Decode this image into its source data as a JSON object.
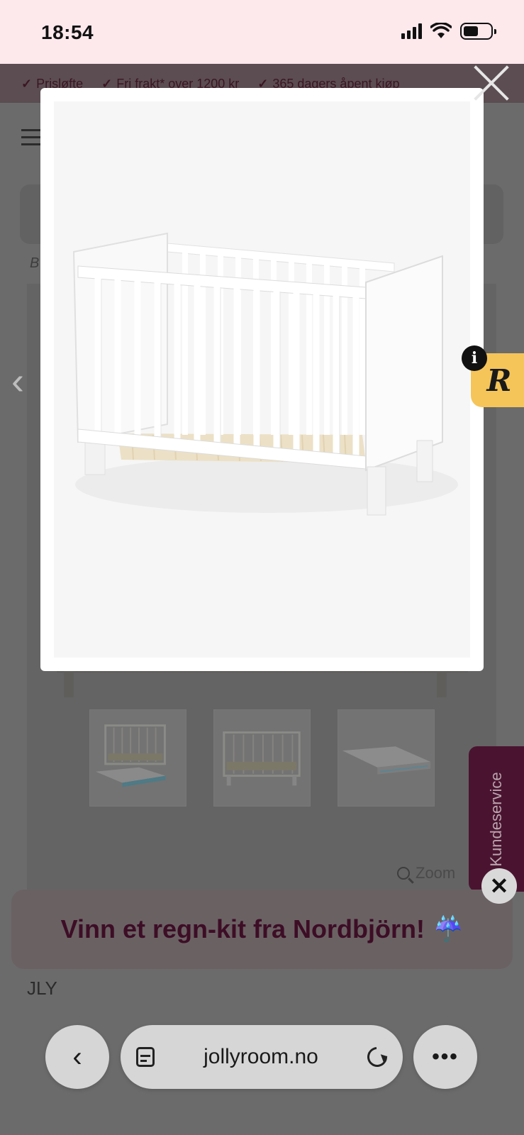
{
  "status_bar": {
    "time": "18:54"
  },
  "usp_bar": {
    "items": [
      {
        "check": "✓",
        "label": "Prisløfte"
      },
      {
        "check": "✓",
        "label": "Fri frakt* over 1200 kr"
      },
      {
        "check": "✓",
        "label": "365 dagers åpent kjøp"
      }
    ]
  },
  "breadcrumb": {
    "first": "B"
  },
  "badge": {
    "letter": "R",
    "info": "i"
  },
  "gallery": {
    "thumbnails": [
      {
        "alt": "crib-with-mattress"
      },
      {
        "alt": "crib"
      },
      {
        "alt": "mattress"
      }
    ],
    "zoom_label": "Zoom"
  },
  "kundeservice": {
    "label": "Kundeservice"
  },
  "promo": {
    "text": "Vinn et regn-kit fra Nordbjörn!",
    "emoji": "☔",
    "close": "✕"
  },
  "product": {
    "brand_partial": "JLY"
  },
  "browser": {
    "url": "jollyroom.no",
    "back": "‹",
    "more": "•••"
  },
  "colors": {
    "status_bg": "#fde8ec",
    "promo_text": "#3d0d26",
    "kundeservice_bg": "#4a1430",
    "badge": "#f5c55a"
  }
}
